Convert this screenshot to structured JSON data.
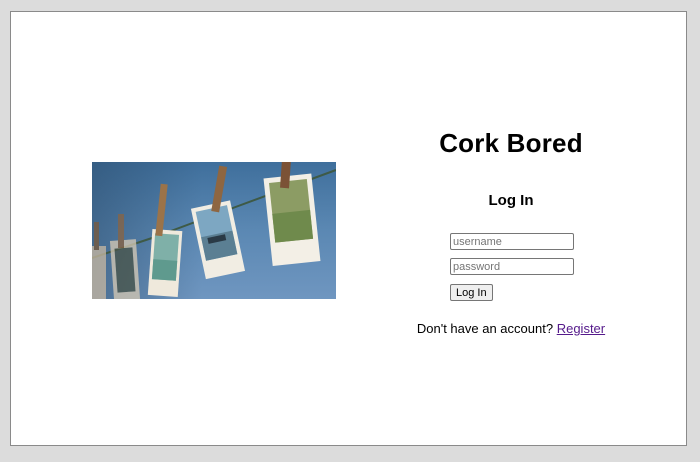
{
  "app": {
    "title": "Cork Bored"
  },
  "login": {
    "heading": "Log In",
    "username_placeholder": "username",
    "password_placeholder": "password",
    "submit_label": "Log In"
  },
  "footer": {
    "prompt": "Don't have an account?",
    "register_label": "Register"
  },
  "colors": {
    "page_background": "#dcdcdc",
    "panel_background": "#ffffff",
    "link_visited": "#551a8b"
  },
  "hero_image": {
    "subject": "polaroid photos hanging on a clothesline with wooden pins against a blue sky"
  }
}
